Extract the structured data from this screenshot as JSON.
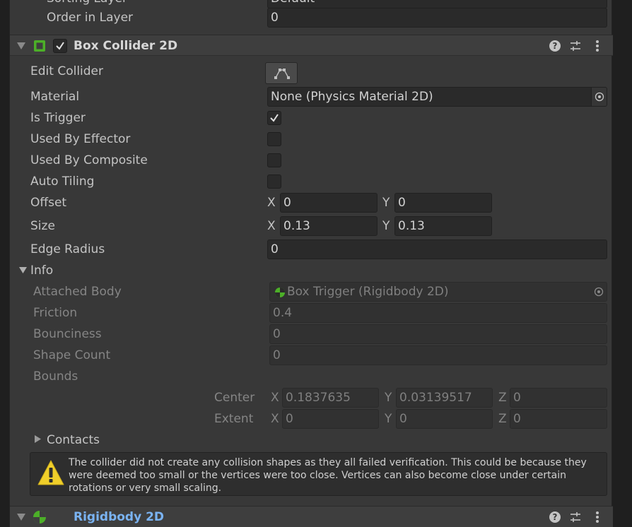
{
  "top": {
    "sorting_layer_label": "Sorting Layer",
    "sorting_layer_value": "Default",
    "order_in_layer_label": "Order in Layer",
    "order_in_layer_value": "0"
  },
  "box_collider": {
    "title": "Box Collider 2D",
    "enabled": true,
    "edit_collider_label": "Edit Collider",
    "material_label": "Material",
    "material_value": "None (Physics Material 2D)",
    "is_trigger_label": "Is Trigger",
    "is_trigger": true,
    "used_by_effector_label": "Used By Effector",
    "used_by_effector": false,
    "used_by_composite_label": "Used By Composite",
    "used_by_composite": false,
    "auto_tiling_label": "Auto Tiling",
    "auto_tiling": false,
    "offset_label": "Offset",
    "offset_x": "0",
    "offset_y": "0",
    "size_label": "Size",
    "size_x": "0.13",
    "size_y": "0.13",
    "edge_radius_label": "Edge Radius",
    "edge_radius_value": "0",
    "axis_x": "X",
    "axis_y": "Y",
    "axis_z": "Z"
  },
  "info": {
    "label": "Info",
    "attached_body_label": "Attached Body",
    "attached_body_value": "Box Trigger (Rigidbody 2D)",
    "friction_label": "Friction",
    "friction_value": "0.4",
    "bounciness_label": "Bounciness",
    "bounciness_value": "0",
    "shape_count_label": "Shape Count",
    "shape_count_value": "0",
    "bounds_label": "Bounds",
    "center_label": "Center",
    "center_x": "0.1837635",
    "center_y": "0.03139517",
    "center_z": "0",
    "extent_label": "Extent",
    "extent_x": "0",
    "extent_y": "0",
    "extent_z": "0",
    "contacts_label": "Contacts"
  },
  "warning": {
    "text": "The collider did not create any collision shapes as they all failed verification.  This could be because they were deemed too small or the vertices were too close.  Vertices can also become close under certain rotations or very small scaling."
  },
  "rigidbody": {
    "title": "Rigidbody 2D"
  },
  "colors": {
    "panel_bg": "#383838",
    "field_bg": "#2a2a2a",
    "accent_green": "#4caf28",
    "link_blue": "#7ab3f2",
    "warning_yellow": "#f0cf2a"
  },
  "icons": {
    "help": "help-icon",
    "presets": "presets-icon",
    "more": "kebab-menu-icon",
    "edit_collider": "edit-collider-icon",
    "object_picker": "object-picker-icon"
  }
}
